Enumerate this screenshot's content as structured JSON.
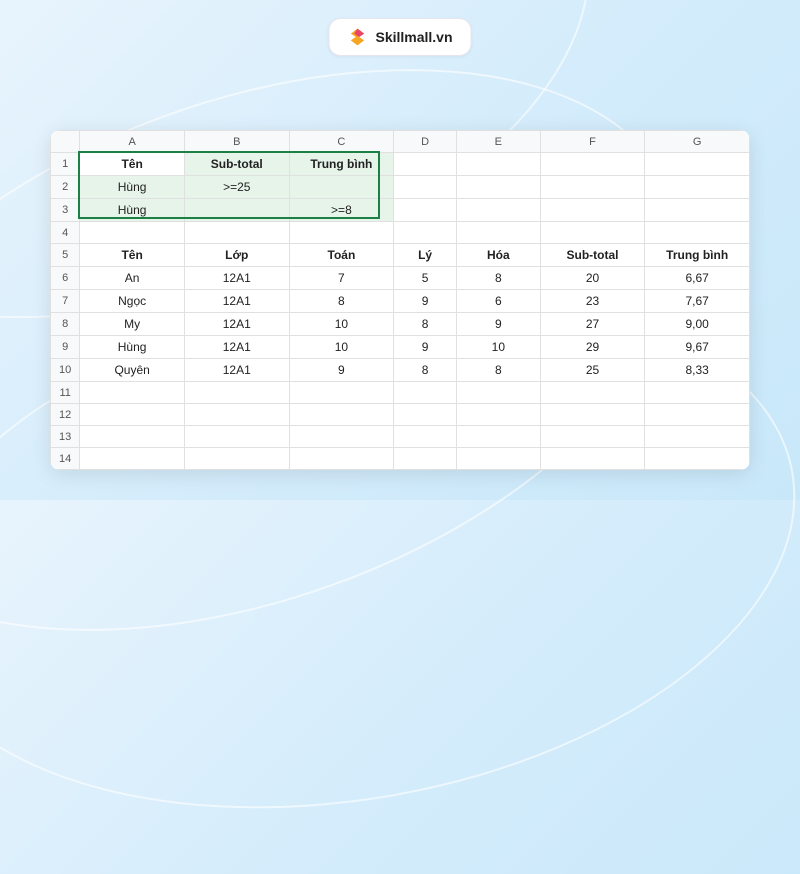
{
  "brand": {
    "name": "Skillmall.vn"
  },
  "columns": [
    "A",
    "B",
    "C",
    "D",
    "E",
    "F",
    "G"
  ],
  "criteria": {
    "headers": [
      "Tên",
      "Sub-total",
      "Trung bình"
    ],
    "rows": [
      [
        "Hùng",
        ">=25",
        ""
      ],
      [
        "Hùng",
        "",
        ">=8"
      ]
    ],
    "activeCell": "Tên"
  },
  "data": {
    "headers": [
      "Tên",
      "Lớp",
      "Toán",
      "Lý",
      "Hóa",
      "Sub-total",
      "Trung bình"
    ],
    "rows": [
      [
        "An",
        "12A1",
        "7",
        "5",
        "8",
        "20",
        "6,67"
      ],
      [
        "Ngọc",
        "12A1",
        "8",
        "9",
        "6",
        "23",
        "7,67"
      ],
      [
        "My",
        "12A1",
        "10",
        "8",
        "9",
        "27",
        "9,00"
      ],
      [
        "Hùng",
        "12A1",
        "10",
        "9",
        "10",
        "29",
        "9,67"
      ],
      [
        "Quyên",
        "12A1",
        "9",
        "8",
        "8",
        "25",
        "8,33"
      ]
    ]
  },
  "rowNumbers": [
    "1",
    "2",
    "3",
    "4",
    "5",
    "6",
    "7",
    "8",
    "9",
    "10",
    "11",
    "12",
    "13",
    "14"
  ]
}
